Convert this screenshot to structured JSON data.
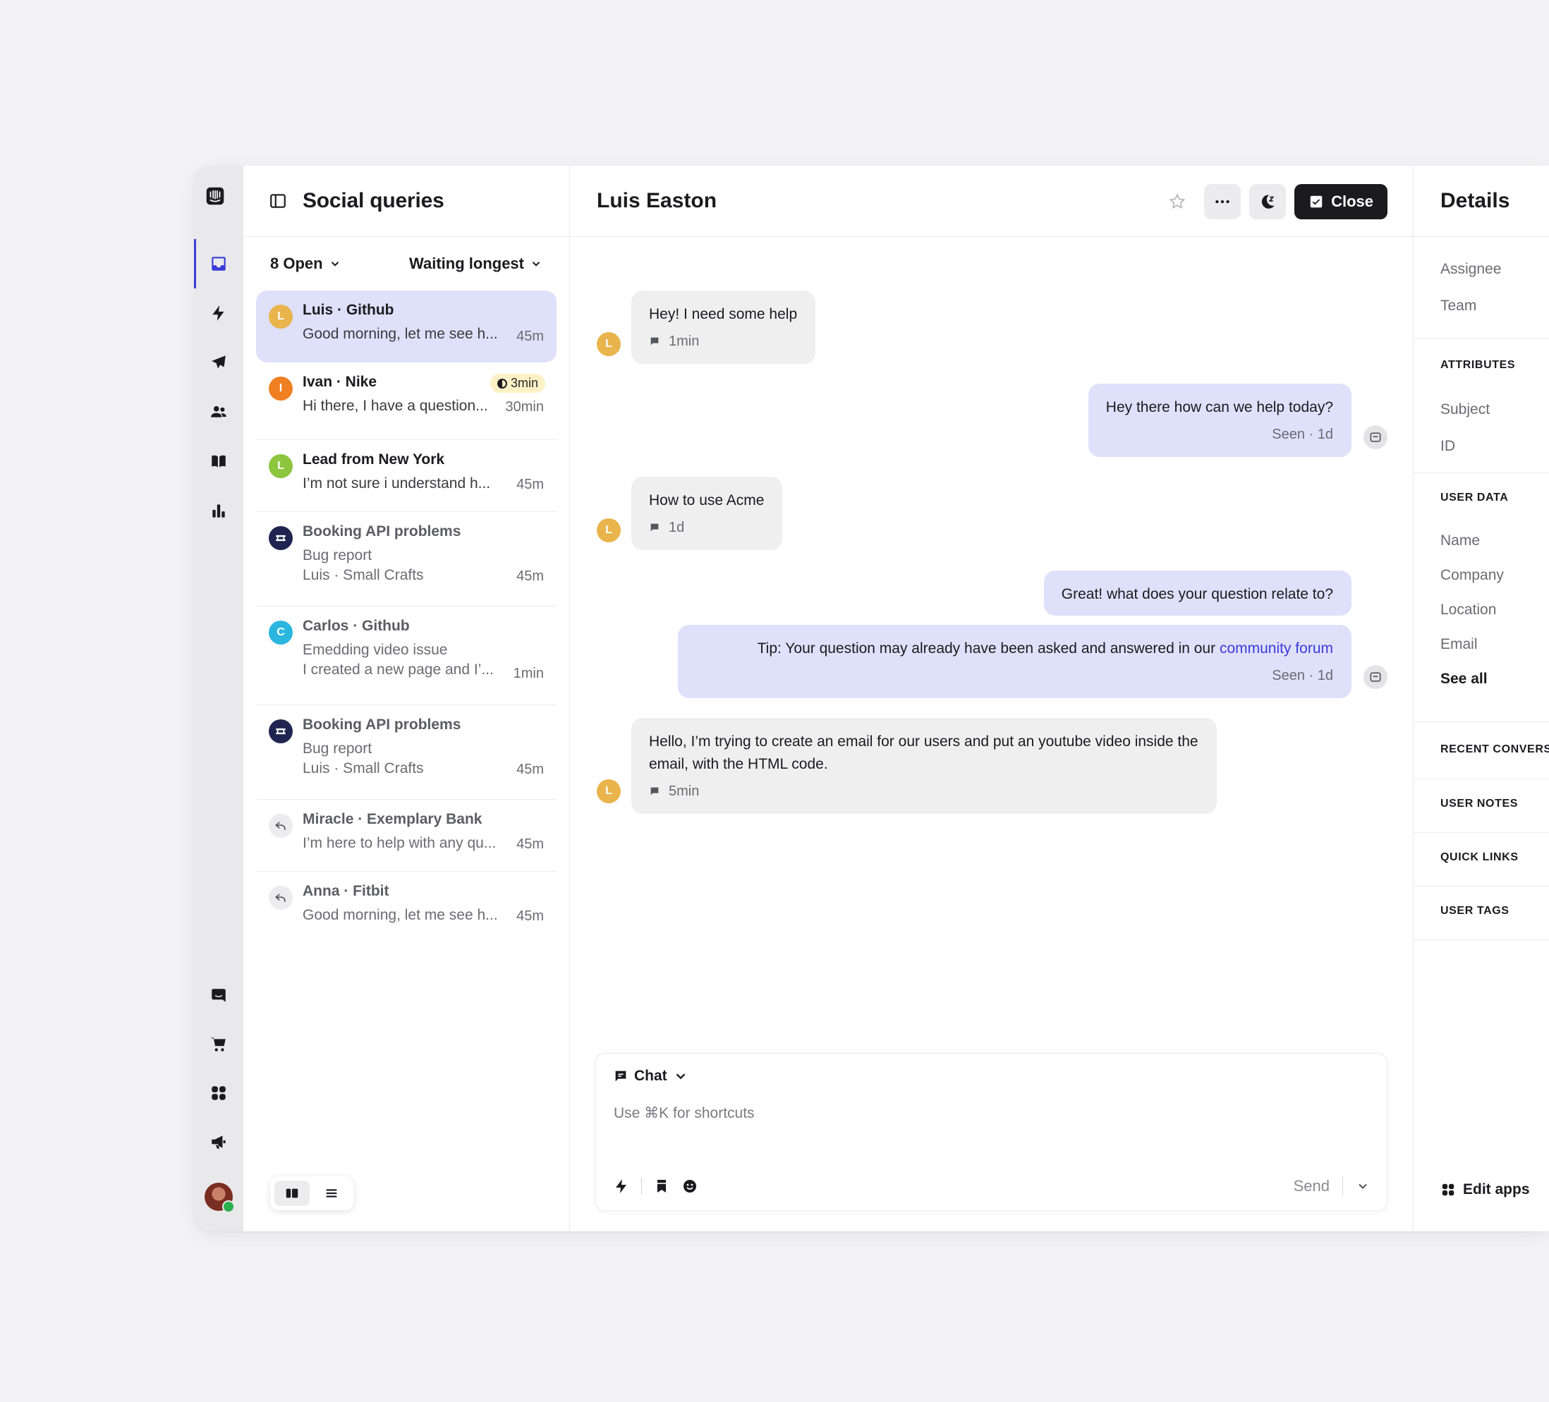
{
  "rail": {
    "logo": "intercom-logo-icon",
    "top_items": [
      "inbox-icon",
      "bolt-icon",
      "paper-plane-icon",
      "users-icon",
      "book-icon",
      "bar-chart-icon"
    ],
    "bottom_items": [
      "messenger-icon",
      "cart-icon",
      "apps-grid-icon",
      "megaphone-icon"
    ]
  },
  "list": {
    "title": "Social queries",
    "filter_open": "8 Open",
    "filter_sort": "Waiting longest",
    "conversations": [
      {
        "initial": "L",
        "color": "#e9b44c",
        "name": "Luis · Github",
        "line1": "Good morning, let me see h...",
        "time": "45m",
        "selected": true
      },
      {
        "initial": "I",
        "color": "#f07f22",
        "name": "Ivan · Nike",
        "line1": "Hi there, I have a question...",
        "time": "30min",
        "badge": "3min"
      },
      {
        "initial": "L",
        "color": "#8cc63f",
        "name": "Lead from New York",
        "line1": "I’m not sure i understand h...",
        "time": "45m"
      },
      {
        "initial": "",
        "color": "#1f2550",
        "name": "Booking API problems",
        "line1": "Bug report",
        "line2": "Luis · Small Crafts",
        "time": "45m"
      },
      {
        "initial": "C",
        "color": "#2bb6e0",
        "name": "Carlos · Github",
        "line1": "Emedding video issue",
        "line2": "I created a new page and I’...",
        "time": "1min"
      },
      {
        "initial": "",
        "color": "#1f2550",
        "name": "Booking API problems",
        "line1": "Bug report",
        "line2": "Luis · Small Crafts",
        "time": "45m"
      },
      {
        "initial": "",
        "color": "#ececee",
        "name": "Miracle · Exemplary Bank",
        "line1": "I’m here to help with any qu...",
        "time": "45m"
      },
      {
        "initial": "",
        "color": "#ececee",
        "name": "Anna · Fitbit",
        "line1": "Good morning, let me see h...",
        "time": "45m"
      }
    ]
  },
  "chat": {
    "title": "Luis Easton",
    "close_label": "Close",
    "messages": [
      {
        "text": "Hey! I need some help",
        "meta": "1min"
      },
      {
        "text": "Hey there how can we help today?",
        "meta": "Seen · 1d"
      },
      {
        "text": "How to use Acme",
        "meta": "1d"
      },
      {
        "text": "Great! what does your question relate to?"
      },
      {
        "text": "Tip: Your question may already have been asked and answered in our ",
        "link": "community forum",
        "meta": "Seen · 1d"
      },
      {
        "text": "Hello, I’m trying to create an email for our users and put an youtube video inside the email, with the HTML code.",
        "meta": "5min"
      }
    ],
    "avatar_initial": "L",
    "composer": {
      "mode": "Chat",
      "placeholder": "Use ⌘K for shortcuts",
      "send": "Send"
    }
  },
  "details": {
    "title": "Details",
    "assignee": "Assignee",
    "team": "Team",
    "attributes_header": "ATTRIBUTES",
    "subject": "Subject",
    "id": "ID",
    "user_data_header": "USER DATA",
    "name": "Name",
    "company": "Company",
    "location": "Location",
    "email": "Email",
    "see_all": "See all",
    "recent_header": "RECENT CONVERS",
    "notes_header": "USER NOTES",
    "links_header": "QUICK LINKS",
    "tags_header": "USER TAGS",
    "edit_apps": "Edit apps"
  }
}
